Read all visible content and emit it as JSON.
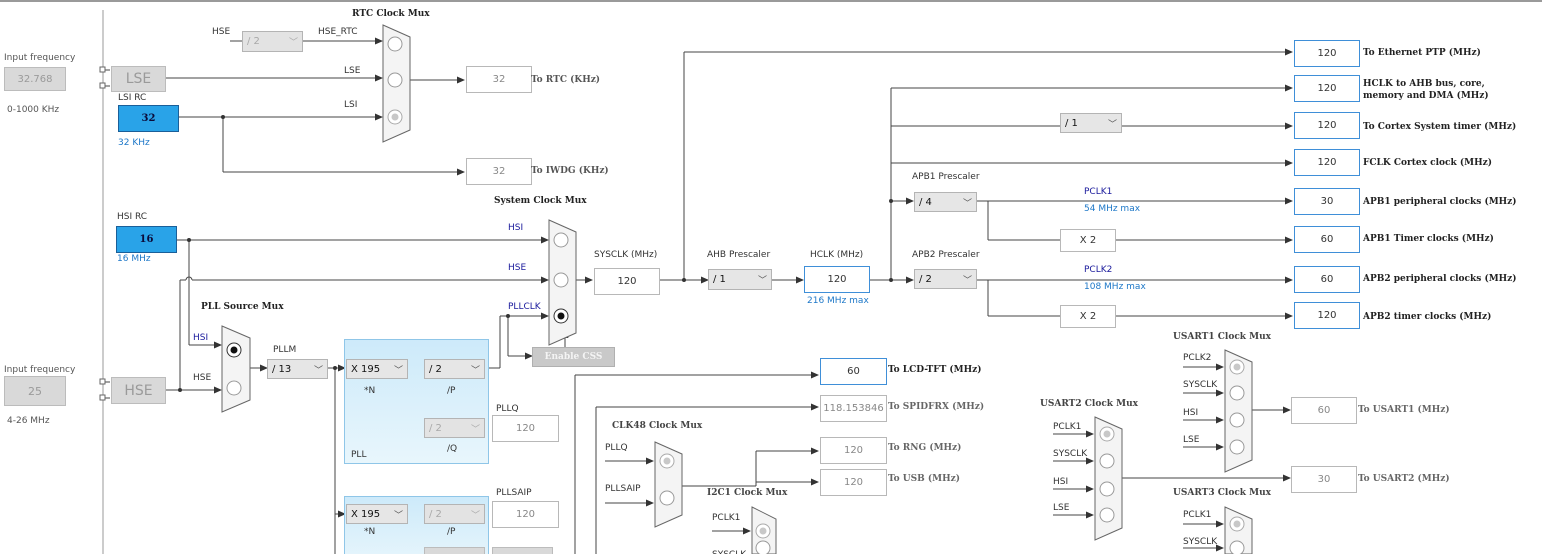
{
  "lse_panel": {
    "input_label": "Input frequency",
    "input_value": "32.768",
    "range": "0-1000 KHz",
    "block": "LSE"
  },
  "lsi": {
    "label": "LSI RC",
    "value": "32",
    "sub": "32 KHz"
  },
  "hsi": {
    "label": "HSI RC",
    "value": "16",
    "sub": "16 MHz"
  },
  "hse_panel": {
    "input_label": "Input frequency",
    "input_value": "25",
    "range": "4-26 MHz",
    "block": "HSE"
  },
  "rtc_mux": {
    "title": "RTC Clock Mux",
    "hse_in": "HSE",
    "prescaler": "/ 2",
    "hse_rtc": "HSE_RTC",
    "lse_in": "LSE",
    "lsi_in": "LSI",
    "out_value": "32",
    "out_label": "To RTC (KHz)"
  },
  "iwdg": {
    "value": "32",
    "label": "To IWDG (KHz)"
  },
  "sys_mux": {
    "title": "System Clock Mux",
    "hsi_in": "HSI",
    "hse_in": "HSE",
    "pllclk_in": "PLLCLK"
  },
  "sysclk": {
    "label": "SYSCLK (MHz)",
    "value": "120"
  },
  "css_button": "Enable CSS",
  "pll_source_mux": {
    "title": "PLL Source Mux",
    "hsi_in": "HSI",
    "hse_in": "HSE"
  },
  "pllm": {
    "label": "PLLM",
    "value": "/ 13"
  },
  "pll": {
    "n_value": "X 195",
    "n_label": "*N",
    "p_value": "/ 2",
    "p_label": "/P",
    "q_value": "/ 2",
    "q_label": "/Q",
    "name": "PLL",
    "pllq_label": "PLLQ",
    "pllq_value": "120"
  },
  "pllsai": {
    "label": "PLLSAIP",
    "n_value": "X 195",
    "n_label": "*N",
    "p_value": "/ 2",
    "p_label": "/P",
    "out_value": "120"
  },
  "ahb": {
    "label": "AHB Prescaler",
    "value": "/ 1"
  },
  "hclk": {
    "label": "HCLK (MHz)",
    "value": "120",
    "max": "216 MHz max"
  },
  "apb1": {
    "label": "APB1 Prescaler",
    "value": "/ 4",
    "pclk": "PCLK1",
    "max": "54 MHz max",
    "x2": "X 2"
  },
  "apb2": {
    "label": "APB2 Prescaler",
    "value": "/ 2",
    "pclk": "PCLK2",
    "max": "108 MHz max",
    "x2": "X 2"
  },
  "cortex_div": "/ 1",
  "outputs": [
    {
      "value": "120",
      "label": "To Ethernet PTP (MHz)"
    },
    {
      "value": "120",
      "label": "HCLK to AHB bus, core,",
      "label2": "memory and DMA (MHz)"
    },
    {
      "value": "120",
      "label": "To Cortex System timer (MHz)"
    },
    {
      "value": "120",
      "label": "FCLK Cortex clock (MHz)"
    },
    {
      "value": "30",
      "label": "APB1 peripheral clocks (MHz)"
    },
    {
      "value": "60",
      "label": "APB1 Timer clocks (MHz)"
    },
    {
      "value": "60",
      "label": "APB2 peripheral clocks (MHz)"
    },
    {
      "value": "120",
      "label": "APB2 timer clocks (MHz)"
    }
  ],
  "lcd": {
    "value": "60",
    "label": "To LCD-TFT (MHz)"
  },
  "spdif": {
    "value": "118.153846",
    "label": "To SPIDFRX (MHz)"
  },
  "rng": {
    "value": "120",
    "label": "To RNG (MHz)"
  },
  "usb": {
    "value": "120",
    "label": "To USB (MHz)"
  },
  "clk48_mux": {
    "title": "CLK48 Clock Mux",
    "in1": "PLLQ",
    "in2": "PLLSAIP"
  },
  "i2c1_mux": {
    "title": "I2C1 Clock Mux",
    "in1": "PCLK1",
    "in2": "SYSCLK"
  },
  "usart2_mux": {
    "title": "USART2 Clock Mux",
    "in1": "PCLK1",
    "in2": "SYSCLK",
    "in3": "HSI",
    "in4": "LSE",
    "out_value": "30",
    "out_label": "To USART2 (MHz)"
  },
  "usart1_mux": {
    "title": "USART1 Clock Mux",
    "in1": "PCLK2",
    "in2": "SYSCLK",
    "in3": "HSI",
    "in4": "LSE",
    "out_value": "60",
    "out_label": "To USART1 (MHz)"
  },
  "usart3_mux": {
    "title": "USART3 Clock Mux",
    "in1": "PCLK1",
    "in2": "SYSCLK"
  }
}
